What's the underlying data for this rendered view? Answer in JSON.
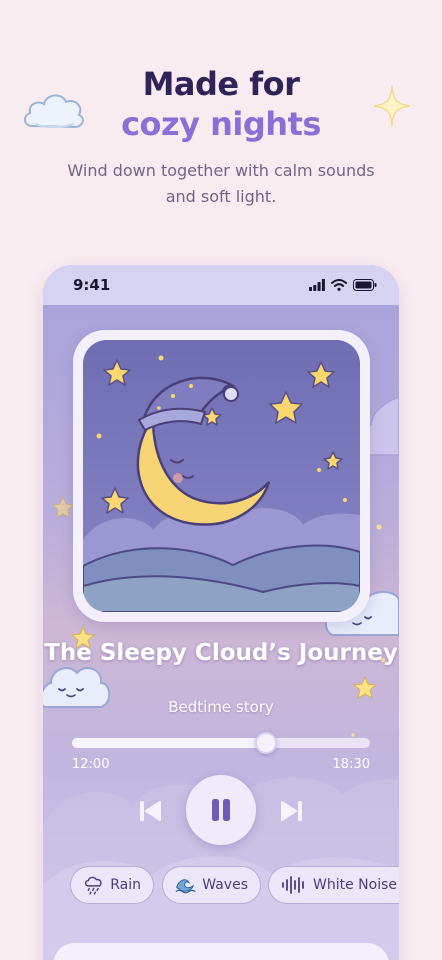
{
  "header": {
    "title_line1": "Made for",
    "title_line2": "cozy nights",
    "subtitle": "Wind down together with calm sounds and soft light."
  },
  "status_bar": {
    "time": "9:41"
  },
  "player": {
    "track_title": "The Sleepy Cloud’s Journey",
    "track_subtitle": "Bedtime story",
    "elapsed": "12:00",
    "duration": "18:30",
    "progress": 0.65
  },
  "chips": [
    {
      "label": "Rain",
      "icon": "rain-cloud-icon"
    },
    {
      "label": "Waves",
      "icon": "waves-icon"
    },
    {
      "label": "White Noise",
      "icon": "sound-wave-icon"
    }
  ],
  "colors": {
    "background": "#f9ecf0",
    "headline_dark": "#2f2458",
    "headline_accent": "#8a6fd6",
    "phone_lavender": "#b3acdf",
    "chip_text": "#4a3f78"
  }
}
